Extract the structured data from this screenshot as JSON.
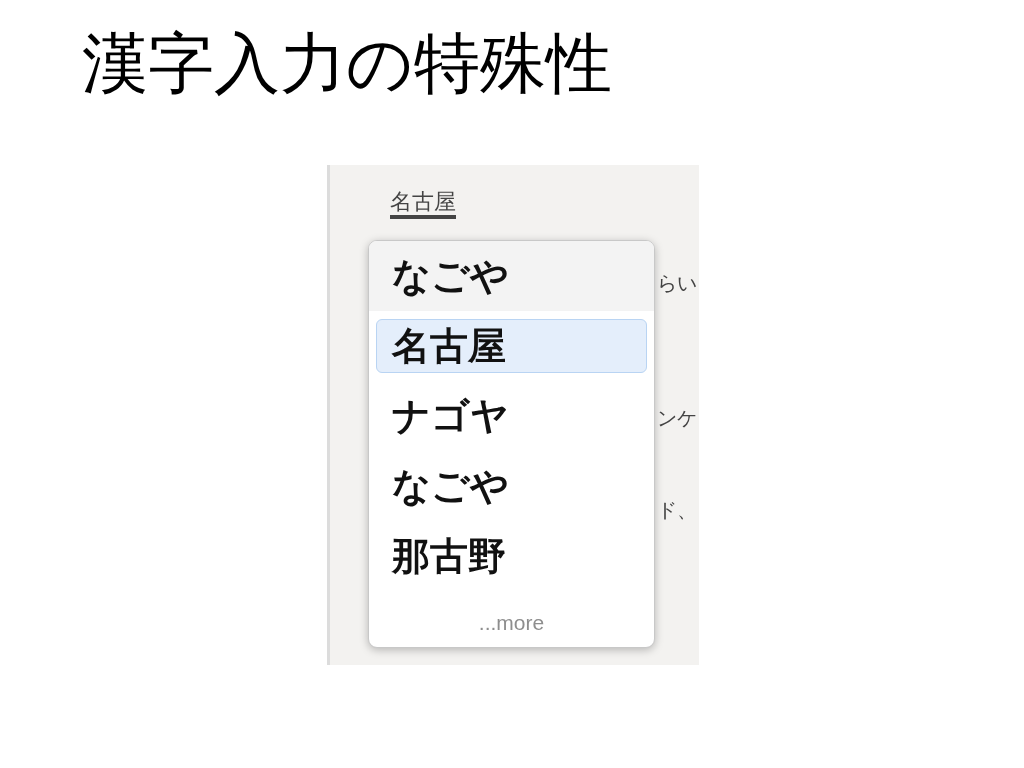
{
  "slide": {
    "title": "漢字入力の特殊性"
  },
  "editor": {
    "composing_text": "名古屋",
    "background_fragments": [
      "らい",
      "ンケ",
      "ド、"
    ]
  },
  "candidate_popup": {
    "items": [
      {
        "kind": "reading",
        "label": "なごや"
      },
      {
        "kind": "candidate",
        "label": "名古屋",
        "selected": true
      },
      {
        "kind": "candidate",
        "label": "ナゴヤ",
        "selected": false
      },
      {
        "kind": "candidate",
        "label": "なごや",
        "selected": false
      },
      {
        "kind": "candidate",
        "label": "那古野",
        "selected": false
      }
    ],
    "more": "...more"
  }
}
